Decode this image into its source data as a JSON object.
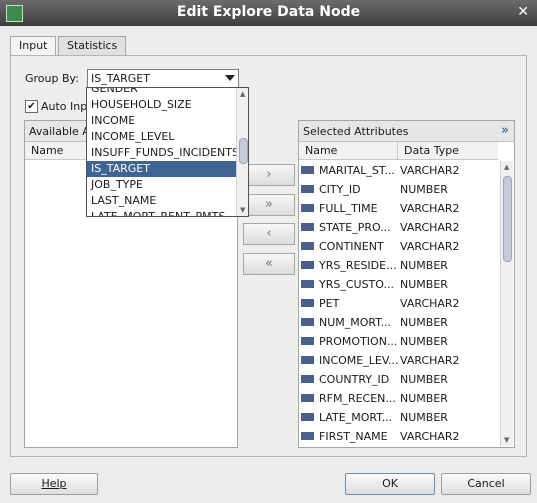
{
  "dialog": {
    "title": "Edit Explore Data Node"
  },
  "tabs": [
    {
      "label": "Input"
    },
    {
      "label": "Statistics"
    }
  ],
  "group_by": {
    "label": "Group By:",
    "value": "IS_TARGET",
    "options_visible": [
      "GENDER",
      "HOUSEHOLD_SIZE",
      "INCOME",
      "INCOME_LEVEL",
      "INSUFF_FUNDS_INCIDENTS",
      "IS_TARGET",
      "JOB_TYPE",
      "LAST_NAME",
      "LATE_MORT_RENT_PMTS"
    ],
    "selected_option": "IS_TARGET"
  },
  "auto_input": {
    "label": "Auto Inp",
    "checked": true
  },
  "available": {
    "header": "Available A",
    "col_name": "Name"
  },
  "move_buttons": {
    "right": "›",
    "all_right": "»",
    "left": "‹",
    "all_left": "«"
  },
  "selected": {
    "header": "Selected Attributes",
    "expand": "»",
    "col_name": "Name",
    "col_type": "Data Type",
    "rows": [
      {
        "name": "MARITAL_ST...",
        "type": "VARCHAR2"
      },
      {
        "name": "CITY_ID",
        "type": "NUMBER"
      },
      {
        "name": "FULL_TIME",
        "type": "VARCHAR2"
      },
      {
        "name": "STATE_PRO...",
        "type": "VARCHAR2"
      },
      {
        "name": "CONTINENT",
        "type": "VARCHAR2"
      },
      {
        "name": "YRS_RESIDE...",
        "type": "NUMBER"
      },
      {
        "name": "YRS_CUSTO...",
        "type": "NUMBER"
      },
      {
        "name": "PET",
        "type": "VARCHAR2"
      },
      {
        "name": "NUM_MORT...",
        "type": "NUMBER"
      },
      {
        "name": "PROMOTION...",
        "type": "NUMBER"
      },
      {
        "name": "INCOME_LEV...",
        "type": "VARCHAR2"
      },
      {
        "name": "COUNTRY_ID",
        "type": "NUMBER"
      },
      {
        "name": "RFM_RECEN...",
        "type": "NUMBER"
      },
      {
        "name": "LATE_MORT...",
        "type": "NUMBER"
      },
      {
        "name": "FIRST_NAME",
        "type": "VARCHAR2"
      }
    ]
  },
  "footer": {
    "help": "Help",
    "ok": "OK",
    "cancel": "Cancel"
  }
}
